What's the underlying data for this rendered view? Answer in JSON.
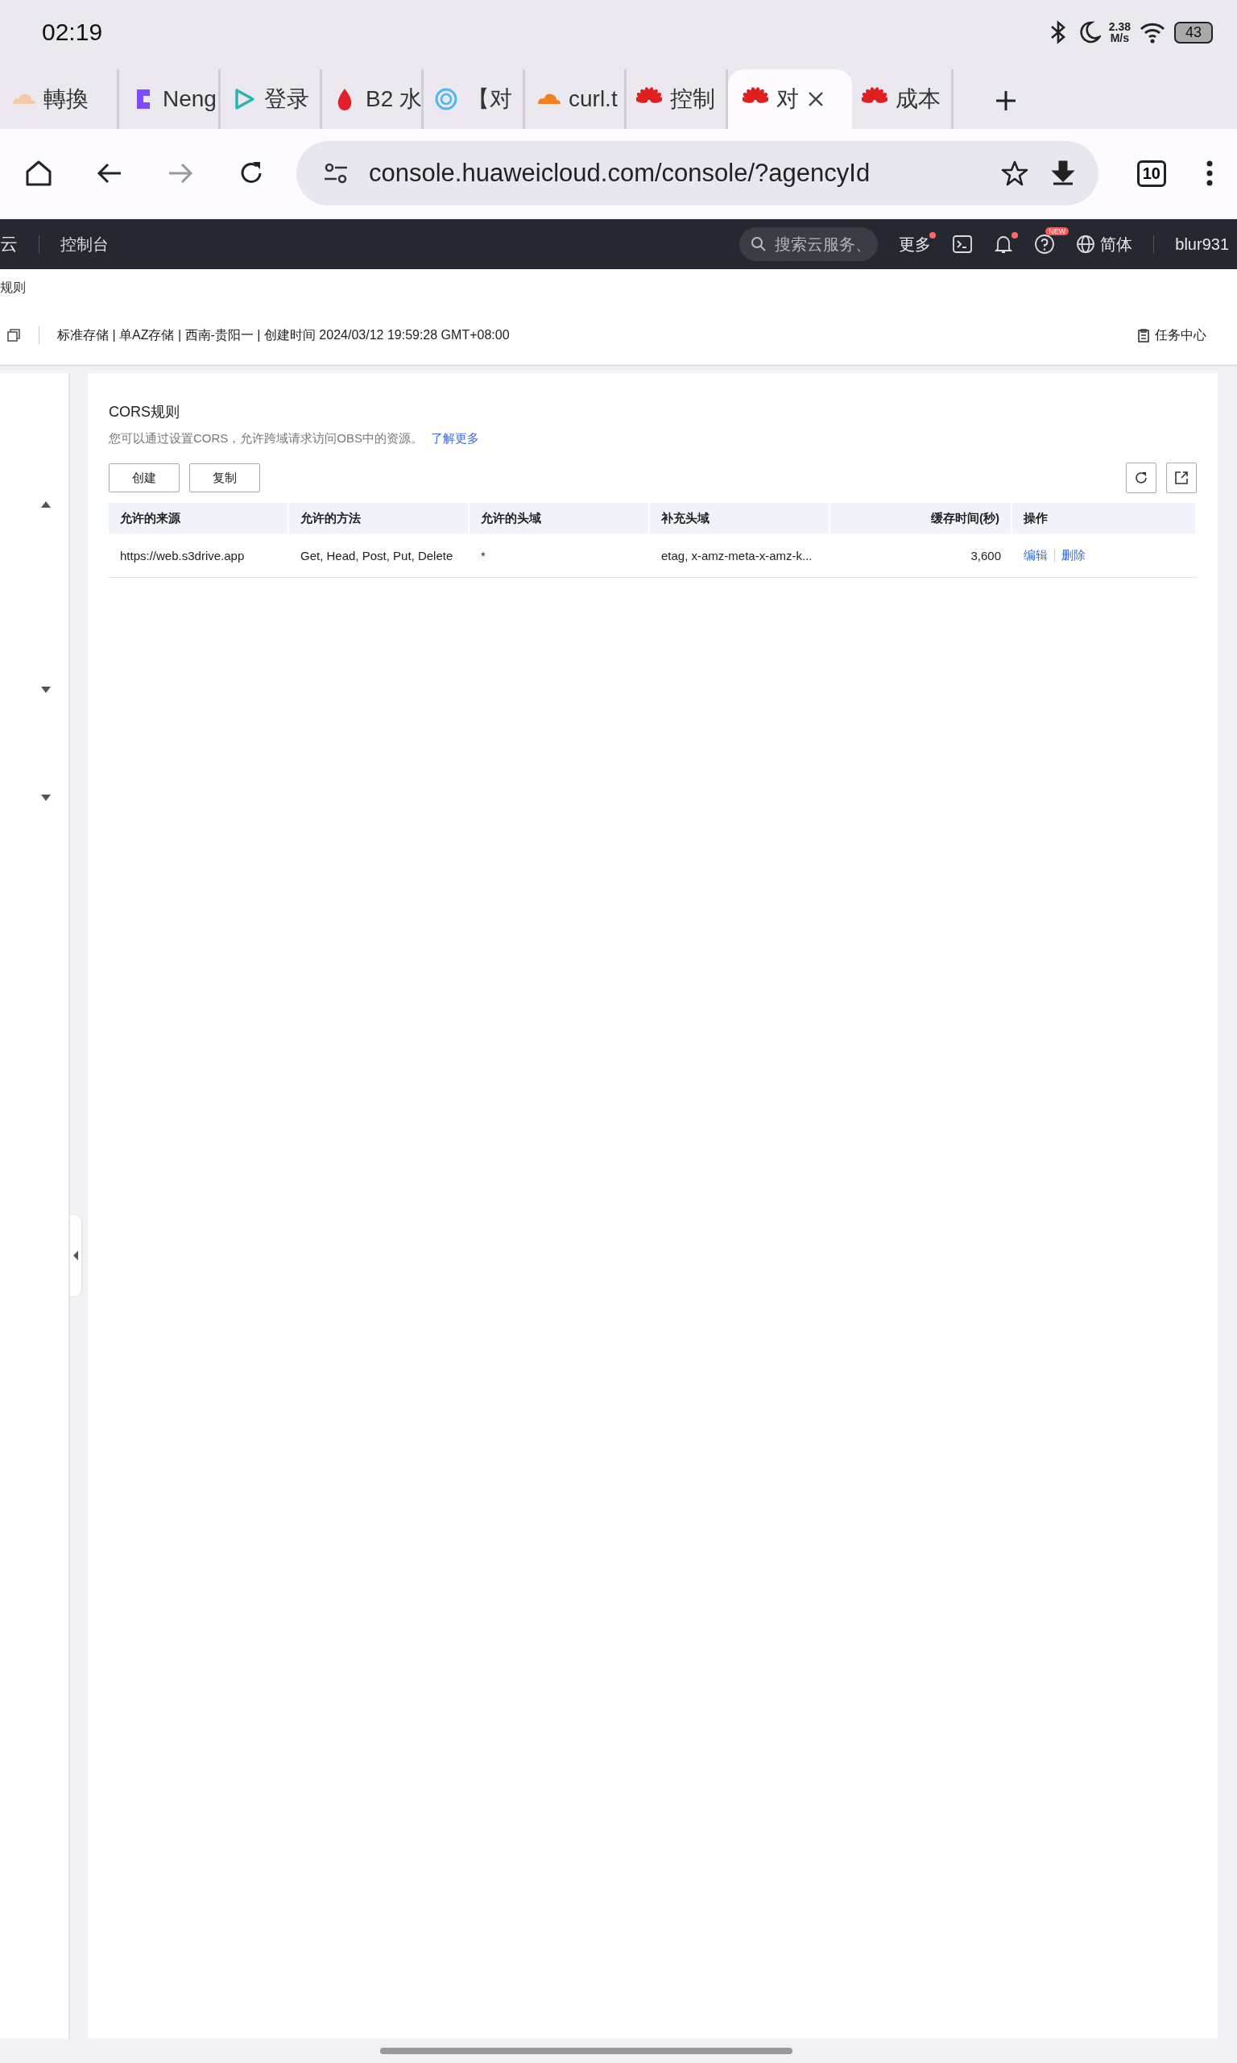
{
  "status_bar": {
    "time": "02:19",
    "speed": "2.38",
    "speed_unit": "M/s",
    "battery": "43"
  },
  "browser_tabs": [
    {
      "label": "轉換",
      "kind": "cloud",
      "color": "#f4c9a8",
      "selected": false
    },
    {
      "label": "Neng",
      "kind": "letter",
      "color": "#7b4dff",
      "selected": false
    },
    {
      "label": "登录",
      "kind": "play",
      "color": "#2bb5b0",
      "selected": false
    },
    {
      "label": "B2 水",
      "kind": "drop",
      "color": "#e0202a",
      "selected": false
    },
    {
      "label": "【对",
      "kind": "ring",
      "color": "#4fb6f0",
      "selected": false
    },
    {
      "label": "curl.t",
      "kind": "cloud",
      "color": "#f38020",
      "selected": false
    },
    {
      "label": "控制",
      "kind": "flower",
      "color": "#e02020",
      "selected": false
    },
    {
      "label": "对",
      "kind": "flower",
      "color": "#e02020",
      "selected": true
    },
    {
      "label": "成本",
      "kind": "flower",
      "color": "#e02020",
      "selected": false
    }
  ],
  "address_bar": {
    "url": "console.huaweicloud.com/console/?agencyId",
    "tab_count": "10"
  },
  "console_header": {
    "brand": "云",
    "title": "控制台",
    "search": {
      "placeholder": "搜索云服务、"
    },
    "more": "更多",
    "help_badge": "NEW",
    "language": "简体",
    "user": "blur931"
  },
  "breadcrumb": "规则",
  "bucket_info": {
    "text": "标准存储 | 单AZ存储 | 西南-贵阳一 | 创建时间  2024/03/12 19:59:28 GMT+08:00",
    "task_center": "任务中心"
  },
  "cors_panel": {
    "title": "CORS规则",
    "description": "您可以通过设置CORS，允许跨域请求访问OBS中的资源。",
    "learn_more": "了解更多",
    "buttons": [
      "创建",
      "复制"
    ],
    "table": {
      "columns": [
        {
          "label": "允许的来源",
          "kind": "text"
        },
        {
          "label": "允许的方法",
          "kind": "text"
        },
        {
          "label": "允许的头域",
          "kind": "text"
        },
        {
          "label": "补充头域",
          "kind": "text"
        },
        {
          "label": "缓存时间(秒)",
          "kind": "number"
        },
        {
          "label": "操作",
          "kind": "text"
        }
      ],
      "rows": [
        {
          "cells": [
            "https://web.s3drive.app",
            "Get, Head, Post, Put, Delete",
            "*",
            "etag, x-amz-meta-x-amz-k...",
            "3,600"
          ],
          "actions": [
            "编辑",
            "删除"
          ]
        }
      ]
    }
  }
}
